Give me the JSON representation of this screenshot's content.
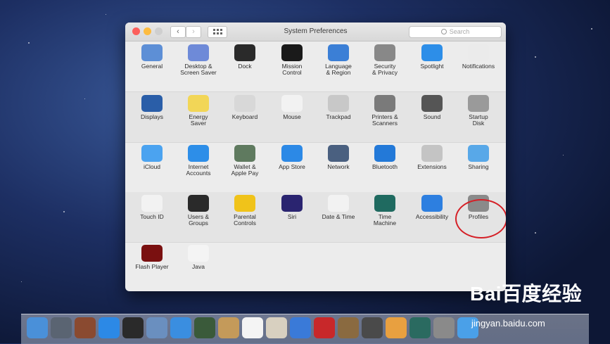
{
  "window": {
    "title": "System Preferences",
    "search_placeholder": "Search",
    "back_glyph": "‹",
    "forward_glyph": "›"
  },
  "rows": [
    [
      {
        "label": "General",
        "icon": "general-icon",
        "color": "#5d8fd6"
      },
      {
        "label": "Desktop &\nScreen Saver",
        "icon": "desktop-icon",
        "color": "#6e8ad8"
      },
      {
        "label": "Dock",
        "icon": "dock-icon",
        "color": "#2a2a2a"
      },
      {
        "label": "Mission\nControl",
        "icon": "mission-control-icon",
        "color": "#1a1a1a"
      },
      {
        "label": "Language\n& Region",
        "icon": "flag-icon",
        "color": "#3b7fd6"
      },
      {
        "label": "Security\n& Privacy",
        "icon": "house-icon",
        "color": "#888888"
      },
      {
        "label": "Spotlight",
        "icon": "spotlight-icon",
        "color": "#2d8ee8"
      },
      {
        "label": "Notifications",
        "icon": "notifications-icon",
        "color": "#ebebeb"
      }
    ],
    [
      {
        "label": "Displays",
        "icon": "display-icon",
        "color": "#2a5ea8"
      },
      {
        "label": "Energy\nSaver",
        "icon": "bulb-icon",
        "color": "#f2d657"
      },
      {
        "label": "Keyboard",
        "icon": "keyboard-icon",
        "color": "#d8d8d8"
      },
      {
        "label": "Mouse",
        "icon": "mouse-icon",
        "color": "#f2f2f2"
      },
      {
        "label": "Trackpad",
        "icon": "trackpad-icon",
        "color": "#c8c8c8"
      },
      {
        "label": "Printers &\nScanners",
        "icon": "printer-icon",
        "color": "#7a7a7a"
      },
      {
        "label": "Sound",
        "icon": "speaker-icon",
        "color": "#555555"
      },
      {
        "label": "Startup\nDisk",
        "icon": "disk-icon",
        "color": "#9a9a9a"
      }
    ],
    [
      {
        "label": "iCloud",
        "icon": "cloud-icon",
        "color": "#4ba3f0"
      },
      {
        "label": "Internet\nAccounts",
        "icon": "at-icon",
        "color": "#2d8ee8"
      },
      {
        "label": "Wallet &\nApple Pay",
        "icon": "wallet-icon",
        "color": "#5f7a5f"
      },
      {
        "label": "App Store",
        "icon": "app-store-icon",
        "color": "#2c89e6"
      },
      {
        "label": "Network",
        "icon": "globe-icon",
        "color": "#4a6080"
      },
      {
        "label": "Bluetooth",
        "icon": "bluetooth-icon",
        "color": "#2379d8"
      },
      {
        "label": "Extensions",
        "icon": "puzzle-icon",
        "color": "#c4c4c4"
      },
      {
        "label": "Sharing",
        "icon": "folder-icon",
        "color": "#58a8e8"
      }
    ],
    [
      {
        "label": "Touch ID",
        "icon": "fingerprint-icon",
        "color": "#f2f2f2"
      },
      {
        "label": "Users &\nGroups",
        "icon": "users-icon",
        "color": "#2a2a2a"
      },
      {
        "label": "Parental\nControls",
        "icon": "parental-icon",
        "color": "#f0c31a"
      },
      {
        "label": "Siri",
        "icon": "siri-icon",
        "color": "#2a2470"
      },
      {
        "label": "Date & Time",
        "icon": "clock-icon",
        "color": "#f2f2f2"
      },
      {
        "label": "Time\nMachine",
        "icon": "time-machine-icon",
        "color": "#1f6a60"
      },
      {
        "label": "Accessibility",
        "icon": "accessibility-icon",
        "color": "#2d7fe0"
      },
      {
        "label": "Profiles",
        "icon": "profiles-icon",
        "color": "#8a8a8a"
      }
    ],
    [
      {
        "label": "Flash Player",
        "icon": "flash-icon",
        "color": "#7a1010"
      },
      {
        "label": "Java",
        "icon": "java-icon",
        "color": "#f4f4f4"
      }
    ]
  ],
  "dock_items": [
    {
      "name": "finder-icon",
      "color": "#4a90d9"
    },
    {
      "name": "launchpad-icon",
      "color": "#5a6472"
    },
    {
      "name": "photos-booth-icon",
      "color": "#8a4a30"
    },
    {
      "name": "app-store-dock-icon",
      "color": "#2c89e6"
    },
    {
      "name": "dashboard-icon",
      "color": "#2a2a2a"
    },
    {
      "name": "preview-icon",
      "color": "#6a8fbf"
    },
    {
      "name": "safari-icon",
      "color": "#3a8ee0"
    },
    {
      "name": "facetime-icon",
      "color": "#3a5a3a"
    },
    {
      "name": "contacts-icon",
      "color": "#c49a5a"
    },
    {
      "name": "calendar-icon",
      "color": "#f4f4f4"
    },
    {
      "name": "photos-icon",
      "color": "#d8d0c0"
    },
    {
      "name": "itunes-icon",
      "color": "#3a7ad8"
    },
    {
      "name": "photo-booth-icon",
      "color": "#c8282a"
    },
    {
      "name": "iphoto-icon",
      "color": "#8a6a40"
    },
    {
      "name": "imovie-icon",
      "color": "#4a4a4a"
    },
    {
      "name": "garageband-icon",
      "color": "#e8a040"
    },
    {
      "name": "time-machine-dock-icon",
      "color": "#2a6a60"
    },
    {
      "name": "system-preferences-dock-icon",
      "color": "#8a8a8a"
    },
    {
      "name": "twitter-icon",
      "color": "#4aa0e8"
    }
  ],
  "watermark": {
    "logo": "Bai百度经验",
    "url": "jingyan.baidu.com"
  }
}
